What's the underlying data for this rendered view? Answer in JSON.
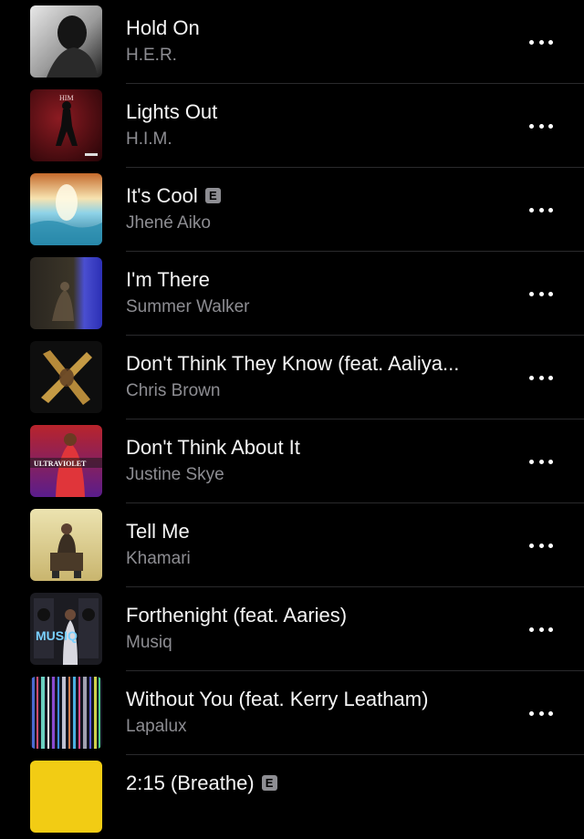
{
  "songs": [
    {
      "title": "Hold On",
      "artist": "H.E.R.",
      "explicit": false,
      "art_text": ""
    },
    {
      "title": "Lights Out",
      "artist": "H.I.M.",
      "explicit": false,
      "art_text": "HIM"
    },
    {
      "title": "It's Cool",
      "artist": "Jhené Aiko",
      "explicit": true,
      "art_text": ""
    },
    {
      "title": "I'm There",
      "artist": "Summer Walker",
      "explicit": false,
      "art_text": ""
    },
    {
      "title": "Don't Think They Know (feat. Aaliya...",
      "artist": "Chris Brown",
      "explicit": false,
      "art_text": ""
    },
    {
      "title": "Don't Think About It",
      "artist": "Justine Skye",
      "explicit": false,
      "art_text": "ULTRAVIOLET"
    },
    {
      "title": "Tell Me",
      "artist": "Khamari",
      "explicit": false,
      "art_text": ""
    },
    {
      "title": "Forthenight (feat. Aaries)",
      "artist": "Musiq",
      "explicit": false,
      "art_text": "MUSIQ"
    },
    {
      "title": "Without You (feat. Kerry Leatham)",
      "artist": "Lapalux",
      "explicit": false,
      "art_text": ""
    },
    {
      "title": "2:15 (Breathe)",
      "artist": "",
      "explicit": true,
      "art_text": ""
    }
  ],
  "explicit_badge": "E",
  "icons": {
    "more": "ellipsis-icon"
  },
  "colors": {
    "background": "#000000",
    "title": "#f5f5f5",
    "subtitle": "#8d8d92",
    "divider": "#2a2a2c"
  }
}
